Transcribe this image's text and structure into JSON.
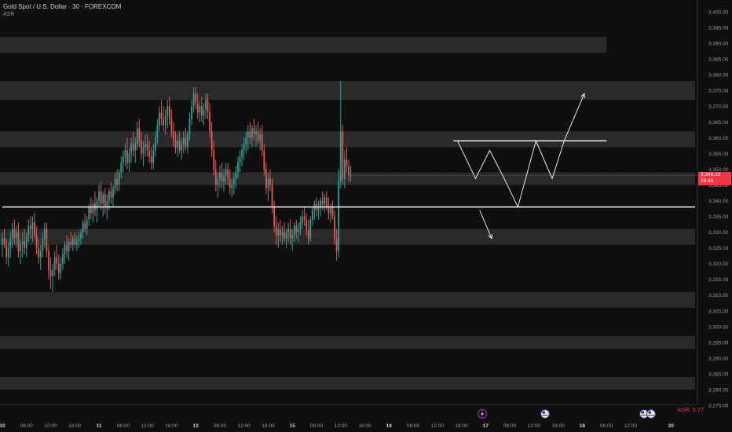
{
  "header": {
    "symbol_title": "Gold Spot / U.S. Dollar · 30 · FOREXCOM",
    "indicator": "ASR"
  },
  "price_tag": {
    "price": "3,348.23",
    "countdown": "28:49"
  },
  "asr_label": "ASR: 5.77",
  "colors": {
    "background": "#0f0f0f",
    "zone": "#2a2a2a",
    "up": "#26a69a",
    "down": "#ef5350",
    "price_tag": "#f23645",
    "drawing": "#ffffff",
    "axis_text": "#9598a1"
  },
  "event_icons": [
    "lightning-icon",
    "us-flag-icon",
    "us-flag-icon",
    "us-flag-icon"
  ],
  "chart_data": {
    "type": "candlestick",
    "title": "Gold Spot / U.S. Dollar · 30 · FOREXCOM",
    "ylim": [
      3272,
      3403
    ],
    "y_ticks": [
      3400,
      3395,
      3390,
      3385,
      3380,
      3375,
      3370,
      3365,
      3360,
      3355,
      3350,
      3345,
      3340,
      3335,
      3330,
      3325,
      3320,
      3315,
      3310,
      3305,
      3300,
      3295,
      3290,
      3285,
      3280,
      3275
    ],
    "x_ticks": [
      {
        "label": "10",
        "pos": 0
      },
      {
        "label": "06:00",
        "pos": 12
      },
      {
        "label": "12:00",
        "pos": 24
      },
      {
        "label": "18:00",
        "pos": 36
      },
      {
        "label": "11",
        "pos": 48
      },
      {
        "label": "06:00",
        "pos": 60
      },
      {
        "label": "12:00",
        "pos": 72
      },
      {
        "label": "18:00",
        "pos": 84
      },
      {
        "label": "13",
        "pos": 96
      },
      {
        "label": "06:00",
        "pos": 108
      },
      {
        "label": "12:00",
        "pos": 120
      },
      {
        "label": "18:00",
        "pos": 132
      },
      {
        "label": "15",
        "pos": 144
      },
      {
        "label": "06:00",
        "pos": 156
      },
      {
        "label": "12:00",
        "pos": 168
      },
      {
        "label": "18:00",
        "pos": 180
      },
      {
        "label": "16",
        "pos": 192
      },
      {
        "label": "06:00",
        "pos": 204
      },
      {
        "label": "12:00",
        "pos": 216
      },
      {
        "label": "18:00",
        "pos": 228
      },
      {
        "label": "17",
        "pos": 240
      },
      {
        "label": "06:00",
        "pos": 252
      },
      {
        "label": "12:00",
        "pos": 264
      },
      {
        "label": "18:00",
        "pos": 276
      },
      {
        "label": "18",
        "pos": 288
      },
      {
        "label": "06:00",
        "pos": 300
      },
      {
        "label": "12:00",
        "pos": 312
      },
      {
        "label": "20",
        "pos": 332
      }
    ],
    "x_range": [
      0,
      344
    ],
    "zones": [
      {
        "from": 3387,
        "to": 3392,
        "x_end": 300
      },
      {
        "from": 3372,
        "to": 3378,
        "x_end": 344
      },
      {
        "from": 3357,
        "to": 3362,
        "x_end": 344
      },
      {
        "from": 3345,
        "to": 3349,
        "x_end": 344
      },
      {
        "from": 3326,
        "to": 3331,
        "x_end": 344
      },
      {
        "from": 3306,
        "to": 3311,
        "x_end": 344
      },
      {
        "from": 3293,
        "to": 3297,
        "x_end": 344
      },
      {
        "from": 3280,
        "to": 3284,
        "x_end": 344
      }
    ],
    "levels": [
      {
        "price": 3338,
        "x_start": 0,
        "x_end": 344
      },
      {
        "price": 3359,
        "x_start": 224,
        "x_end": 300
      }
    ],
    "projection_paths": [
      [
        [
          226,
          3359
        ],
        [
          235,
          3347
        ],
        [
          242,
          3356
        ],
        [
          250,
          3346
        ],
        [
          256,
          3338
        ],
        [
          265,
          3359
        ],
        [
          273,
          3347
        ],
        [
          279,
          3359
        ],
        [
          289,
          3374
        ]
      ],
      [
        [
          237,
          3337
        ],
        [
          243,
          3328
        ]
      ]
    ],
    "candles_start": 0,
    "candles": [
      [
        3326,
        3330,
        3322,
        3328
      ],
      [
        3328,
        3331,
        3325,
        3326
      ],
      [
        3326,
        3328,
        3320,
        3322
      ],
      [
        3322,
        3327,
        3319,
        3325
      ],
      [
        3325,
        3330,
        3322,
        3328
      ],
      [
        3328,
        3333,
        3325,
        3331
      ],
      [
        3331,
        3334,
        3326,
        3328
      ],
      [
        3328,
        3332,
        3325,
        3330
      ],
      [
        3330,
        3333,
        3322,
        3324
      ],
      [
        3324,
        3328,
        3320,
        3326
      ],
      [
        3326,
        3330,
        3322,
        3327
      ],
      [
        3327,
        3331,
        3323,
        3325
      ],
      [
        3325,
        3330,
        3322,
        3329
      ],
      [
        3329,
        3334,
        3327,
        3332
      ],
      [
        3332,
        3335,
        3328,
        3331
      ],
      [
        3331,
        3335,
        3327,
        3333
      ],
      [
        3333,
        3336,
        3328,
        3329
      ],
      [
        3329,
        3332,
        3323,
        3325
      ],
      [
        3325,
        3328,
        3320,
        3322
      ],
      [
        3322,
        3326,
        3318,
        3324
      ],
      [
        3324,
        3330,
        3322,
        3328
      ],
      [
        3328,
        3333,
        3325,
        3331
      ],
      [
        3331,
        3333,
        3322,
        3324
      ],
      [
        3324,
        3326,
        3315,
        3318
      ],
      [
        3318,
        3322,
        3312,
        3316
      ],
      [
        3316,
        3320,
        3311,
        3318
      ],
      [
        3318,
        3324,
        3316,
        3322
      ],
      [
        3322,
        3326,
        3318,
        3320
      ],
      [
        3320,
        3323,
        3315,
        3317
      ],
      [
        3317,
        3322,
        3315,
        3320
      ],
      [
        3320,
        3325,
        3318,
        3323
      ],
      [
        3323,
        3327,
        3320,
        3326
      ],
      [
        3326,
        3329,
        3322,
        3324
      ],
      [
        3324,
        3328,
        3321,
        3327
      ],
      [
        3327,
        3330,
        3325,
        3326
      ],
      [
        3326,
        3329,
        3324,
        3328
      ],
      [
        3328,
        3330,
        3325,
        3326
      ],
      [
        3326,
        3329,
        3324,
        3327
      ],
      [
        3327,
        3330,
        3325,
        3328
      ],
      [
        3328,
        3331,
        3326,
        3330
      ],
      [
        3330,
        3334,
        3328,
        3333
      ],
      [
        3333,
        3336,
        3330,
        3331
      ],
      [
        3331,
        3335,
        3329,
        3334
      ],
      [
        3334,
        3339,
        3332,
        3338
      ],
      [
        3338,
        3341,
        3334,
        3336
      ],
      [
        3336,
        3340,
        3333,
        3339
      ],
      [
        3339,
        3343,
        3335,
        3337
      ],
      [
        3337,
        3341,
        3333,
        3340
      ],
      [
        3340,
        3345,
        3338,
        3343
      ],
      [
        3343,
        3346,
        3337,
        3339
      ],
      [
        3339,
        3343,
        3335,
        3342
      ],
      [
        3342,
        3344,
        3336,
        3338
      ],
      [
        3338,
        3342,
        3334,
        3340
      ],
      [
        3340,
        3344,
        3337,
        3343
      ],
      [
        3343,
        3346,
        3339,
        3341
      ],
      [
        3341,
        3345,
        3338,
        3344
      ],
      [
        3344,
        3349,
        3342,
        3347
      ],
      [
        3347,
        3350,
        3343,
        3345
      ],
      [
        3345,
        3350,
        3343,
        3349
      ],
      [
        3349,
        3354,
        3347,
        3352
      ],
      [
        3352,
        3356,
        3349,
        3354
      ],
      [
        3354,
        3358,
        3351,
        3356
      ],
      [
        3356,
        3360,
        3350,
        3352
      ],
      [
        3352,
        3357,
        3349,
        3355
      ],
      [
        3355,
        3360,
        3352,
        3358
      ],
      [
        3358,
        3362,
        3354,
        3356
      ],
      [
        3356,
        3360,
        3352,
        3358
      ],
      [
        3358,
        3365,
        3356,
        3363
      ],
      [
        3363,
        3366,
        3357,
        3359
      ],
      [
        3359,
        3362,
        3353,
        3355
      ],
      [
        3355,
        3359,
        3351,
        3357
      ],
      [
        3357,
        3361,
        3354,
        3358
      ],
      [
        3358,
        3361,
        3354,
        3356
      ],
      [
        3356,
        3359,
        3352,
        3354
      ],
      [
        3354,
        3357,
        3350,
        3352
      ],
      [
        3352,
        3358,
        3350,
        3356
      ],
      [
        3356,
        3362,
        3354,
        3360
      ],
      [
        3360,
        3366,
        3358,
        3364
      ],
      [
        3364,
        3370,
        3362,
        3368
      ],
      [
        3368,
        3372,
        3364,
        3366
      ],
      [
        3366,
        3370,
        3362,
        3364
      ],
      [
        3364,
        3369,
        3361,
        3367
      ],
      [
        3367,
        3372,
        3363,
        3370
      ],
      [
        3370,
        3373,
        3364,
        3366
      ],
      [
        3366,
        3369,
        3360,
        3362
      ],
      [
        3362,
        3365,
        3357,
        3359
      ],
      [
        3359,
        3362,
        3355,
        3357
      ],
      [
        3357,
        3361,
        3354,
        3359
      ],
      [
        3359,
        3362,
        3355,
        3356
      ],
      [
        3356,
        3360,
        3353,
        3358
      ],
      [
        3358,
        3362,
        3355,
        3360
      ],
      [
        3360,
        3363,
        3356,
        3357
      ],
      [
        3357,
        3362,
        3355,
        3361
      ],
      [
        3361,
        3368,
        3359,
        3366
      ],
      [
        3366,
        3372,
        3364,
        3370
      ],
      [
        3370,
        3376,
        3368,
        3374
      ],
      [
        3374,
        3376,
        3369,
        3371
      ],
      [
        3371,
        3374,
        3366,
        3368
      ],
      [
        3368,
        3372,
        3365,
        3370
      ],
      [
        3370,
        3373,
        3365,
        3367
      ],
      [
        3367,
        3371,
        3364,
        3369
      ],
      [
        3369,
        3374,
        3366,
        3372
      ],
      [
        3372,
        3374,
        3366,
        3368
      ],
      [
        3368,
        3371,
        3360,
        3362
      ],
      [
        3362,
        3365,
        3354,
        3356
      ],
      [
        3356,
        3359,
        3348,
        3350
      ],
      [
        3350,
        3353,
        3343,
        3345
      ],
      [
        3345,
        3349,
        3341,
        3347
      ],
      [
        3347,
        3351,
        3344,
        3349
      ],
      [
        3349,
        3352,
        3344,
        3346
      ],
      [
        3346,
        3350,
        3343,
        3348
      ],
      [
        3348,
        3352,
        3345,
        3350
      ],
      [
        3350,
        3352,
        3345,
        3347
      ],
      [
        3347,
        3350,
        3342,
        3344
      ],
      [
        3344,
        3347,
        3341,
        3345
      ],
      [
        3345,
        3349,
        3342,
        3347
      ],
      [
        3347,
        3351,
        3344,
        3349
      ],
      [
        3349,
        3354,
        3347,
        3352
      ],
      [
        3352,
        3356,
        3349,
        3354
      ],
      [
        3354,
        3358,
        3351,
        3356
      ],
      [
        3356,
        3360,
        3353,
        3358
      ],
      [
        3358,
        3362,
        3355,
        3360
      ],
      [
        3360,
        3364,
        3356,
        3362
      ],
      [
        3362,
        3365,
        3358,
        3360
      ],
      [
        3360,
        3364,
        3357,
        3363
      ],
      [
        3363,
        3366,
        3359,
        3361
      ],
      [
        3361,
        3364,
        3357,
        3362
      ],
      [
        3362,
        3365,
        3358,
        3359
      ],
      [
        3359,
        3363,
        3356,
        3361
      ],
      [
        3361,
        3364,
        3354,
        3356
      ],
      [
        3356,
        3358,
        3348,
        3350
      ],
      [
        3350,
        3352,
        3342,
        3344
      ],
      [
        3344,
        3349,
        3340,
        3347
      ],
      [
        3347,
        3350,
        3343,
        3345
      ],
      [
        3345,
        3347,
        3336,
        3338
      ],
      [
        3338,
        3340,
        3330,
        3332
      ],
      [
        3332,
        3335,
        3326,
        3329
      ],
      [
        3329,
        3333,
        3325,
        3331
      ],
      [
        3331,
        3334,
        3327,
        3329
      ],
      [
        3329,
        3332,
        3326,
        3330
      ],
      [
        3330,
        3333,
        3327,
        3328
      ],
      [
        3328,
        3331,
        3325,
        3330
      ],
      [
        3330,
        3333,
        3327,
        3331
      ],
      [
        3331,
        3334,
        3326,
        3328
      ],
      [
        3328,
        3331,
        3324,
        3329
      ],
      [
        3329,
        3333,
        3327,
        3332
      ],
      [
        3332,
        3334,
        3328,
        3330
      ],
      [
        3330,
        3333,
        3327,
        3331
      ],
      [
        3331,
        3335,
        3329,
        3333
      ],
      [
        3333,
        3337,
        3331,
        3335
      ],
      [
        3335,
        3338,
        3332,
        3334
      ],
      [
        3334,
        3336,
        3329,
        3331
      ],
      [
        3331,
        3334,
        3326,
        3328
      ],
      [
        3328,
        3335,
        3327,
        3334
      ],
      [
        3334,
        3338,
        3332,
        3337
      ],
      [
        3337,
        3340,
        3334,
        3339
      ],
      [
        3339,
        3341,
        3335,
        3337
      ],
      [
        3337,
        3340,
        3334,
        3338
      ],
      [
        3338,
        3341,
        3335,
        3340
      ],
      [
        3340,
        3343,
        3337,
        3339
      ],
      [
        3339,
        3342,
        3336,
        3341
      ],
      [
        3341,
        3343,
        3337,
        3338
      ],
      [
        3338,
        3341,
        3334,
        3336
      ],
      [
        3336,
        3339,
        3333,
        3338
      ],
      [
        3338,
        3340,
        3334,
        3335
      ],
      [
        3335,
        3337,
        3326,
        3328
      ],
      [
        3328,
        3331,
        3321,
        3324
      ],
      [
        3324,
        3350,
        3322,
        3346
      ],
      [
        3346,
        3378,
        3344,
        3362
      ],
      [
        3362,
        3364,
        3345,
        3347
      ],
      [
        3347,
        3356,
        3344,
        3353
      ],
      [
        3353,
        3357,
        3349,
        3351
      ],
      [
        3351,
        3353,
        3346,
        3348
      ],
      [
        3348,
        3351,
        3346,
        3348
      ]
    ]
  }
}
